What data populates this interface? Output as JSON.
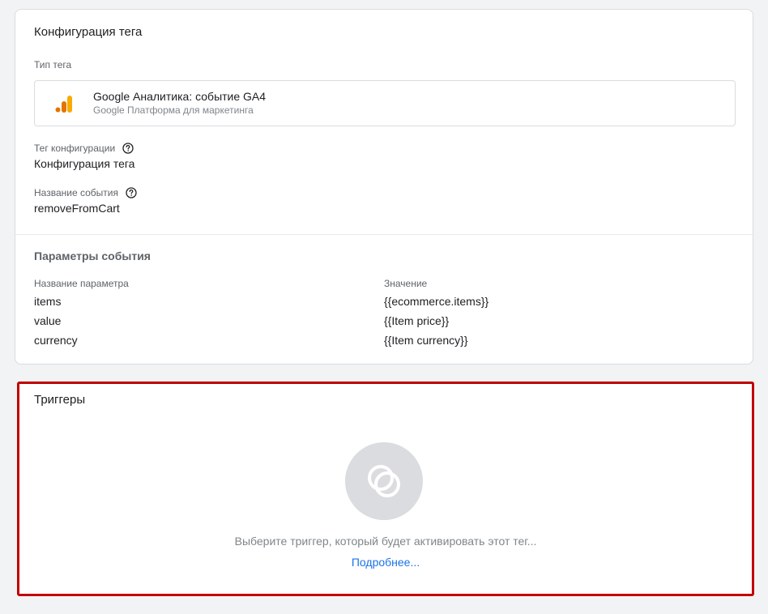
{
  "tag_config": {
    "title": "Конфигурация тега",
    "tag_type_label": "Тип тега",
    "tag_type": {
      "name": "Google Аналитика: событие GA4",
      "platform": "Google Платформа для маркетинга",
      "icon": "google-analytics-icon",
      "icon_colors": [
        "#e37400",
        "#f9ab00"
      ]
    },
    "config_tag_label": "Тег конфигурации",
    "config_tag_value": "Конфигурация тега",
    "event_name_label": "Название события",
    "event_name_value": "removeFromCart",
    "event_params": {
      "title": "Параметры события",
      "col_name": "Название параметра",
      "col_value": "Значение",
      "rows": [
        {
          "name": "items",
          "value": "{{ecommerce.items}}"
        },
        {
          "name": "value",
          "value": "{{Item price}}"
        },
        {
          "name": "currency",
          "value": "{{Item currency}}"
        }
      ]
    }
  },
  "triggers": {
    "title": "Триггеры",
    "empty_text": "Выберите триггер, который будет активировать этот тег...",
    "learn_more": "Подробнее...",
    "icon": "trigger-circles-icon",
    "highlight_color": "#c00000"
  }
}
